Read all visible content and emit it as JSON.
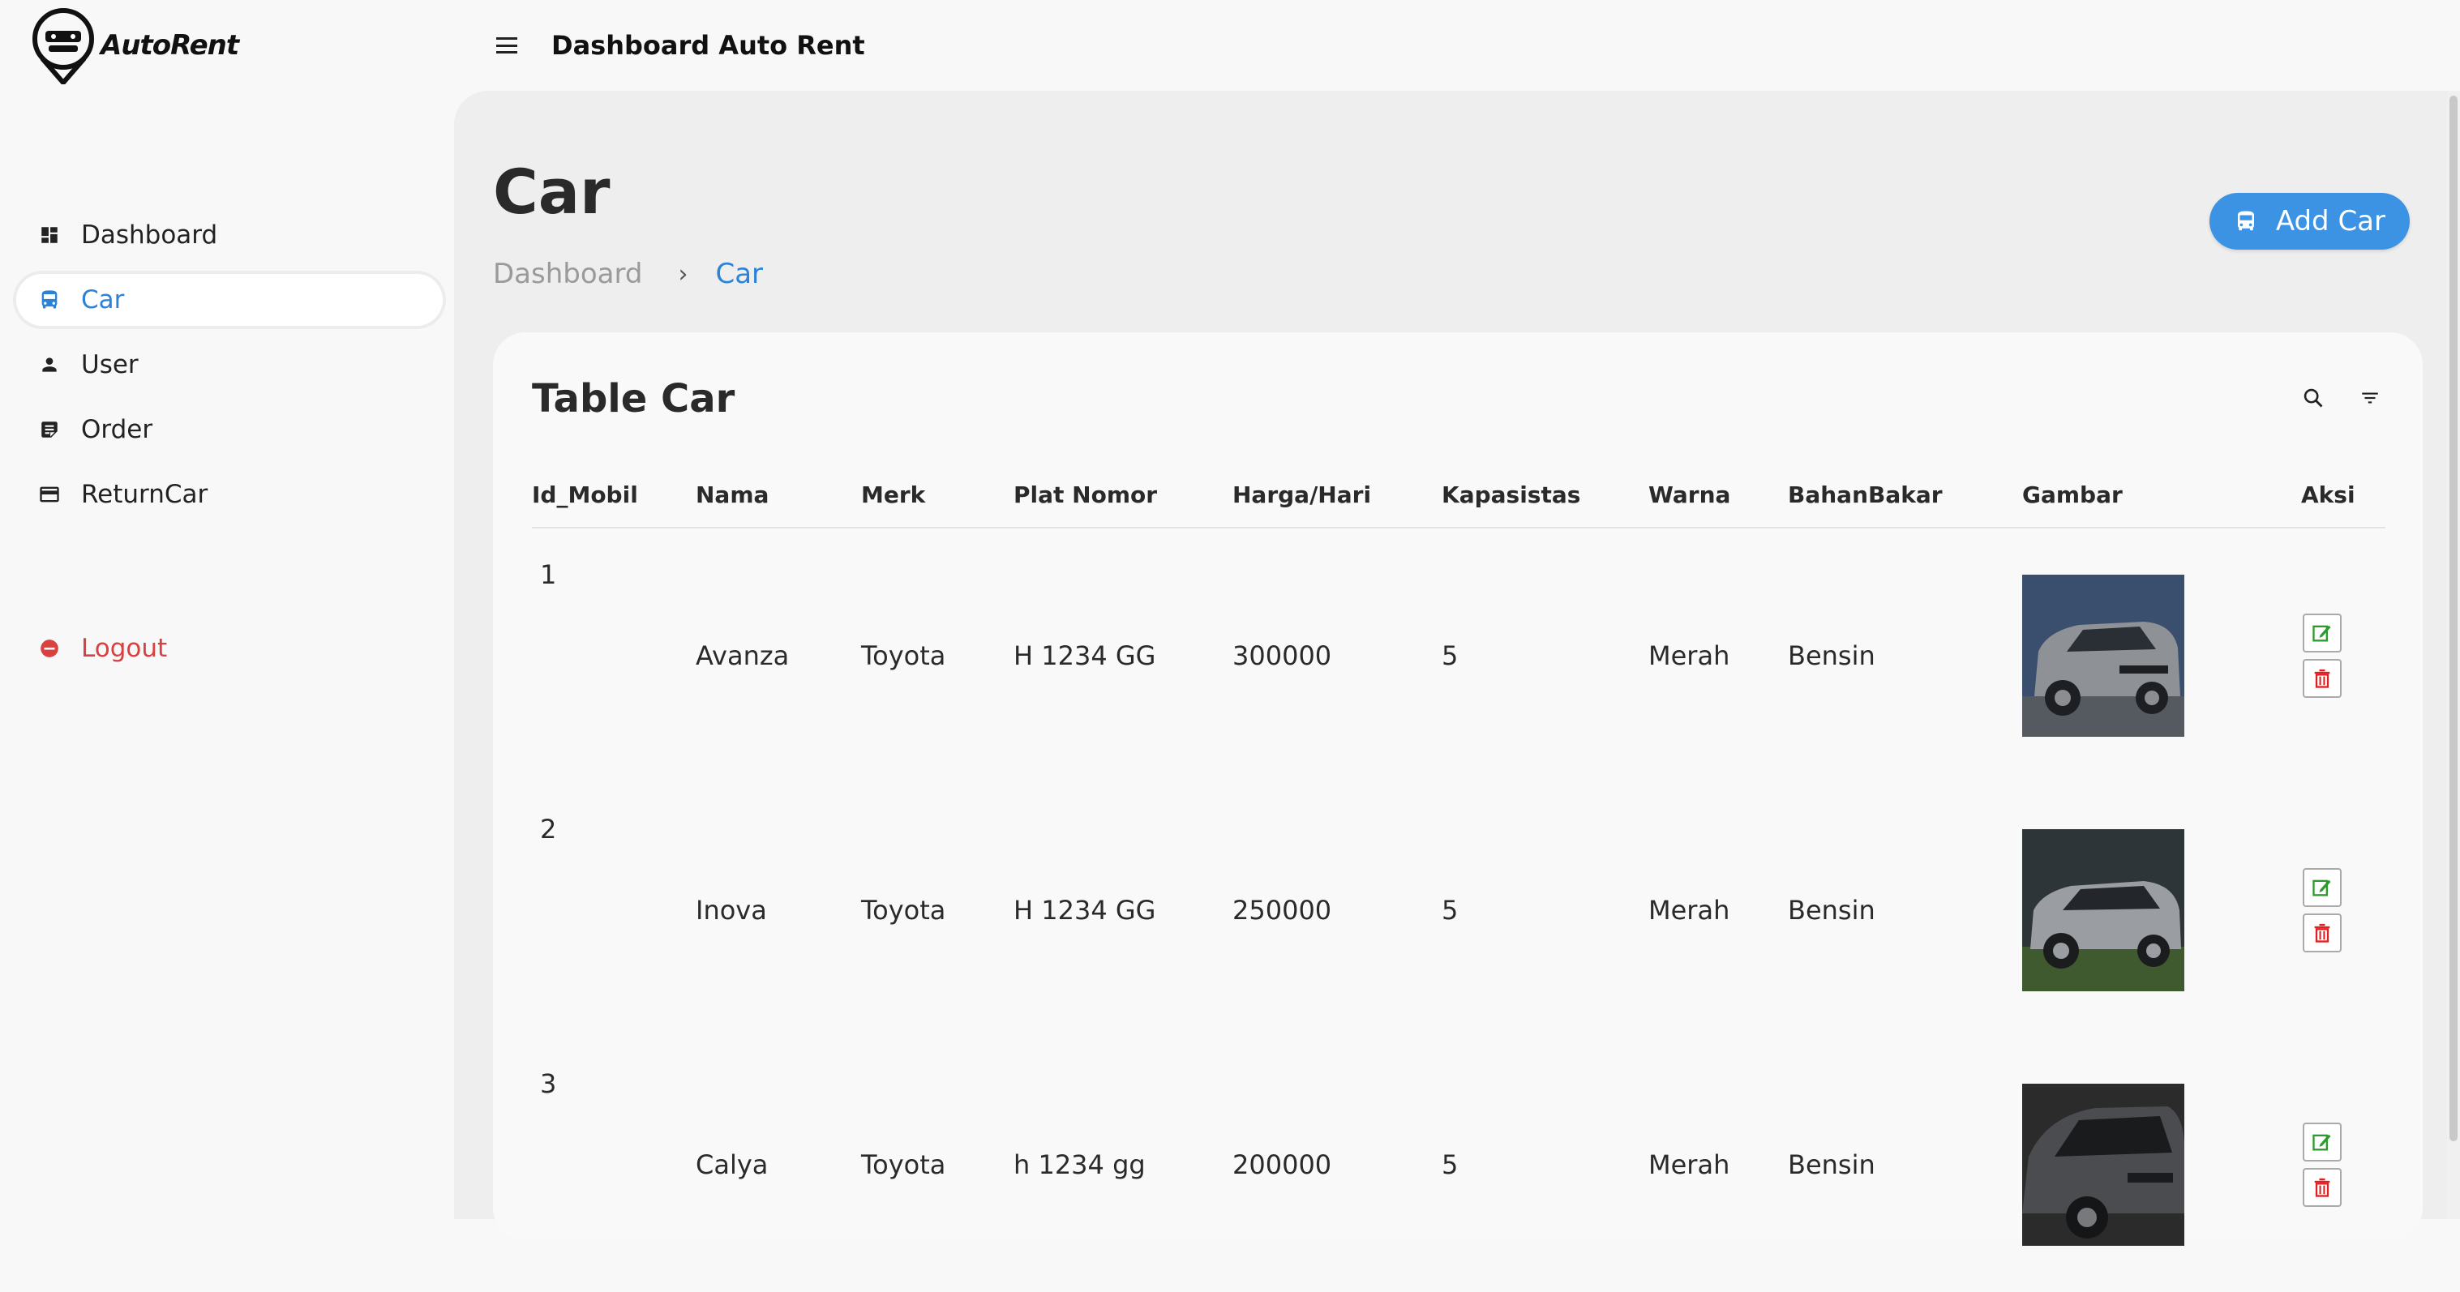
{
  "brand": {
    "name": "AutoRent"
  },
  "sidebar": {
    "items": [
      {
        "label": "Dashboard",
        "icon": "dashboard-icon"
      },
      {
        "label": "Car",
        "icon": "car-icon",
        "active": true
      },
      {
        "label": "User",
        "icon": "person-icon"
      },
      {
        "label": "Order",
        "icon": "order-icon"
      },
      {
        "label": "ReturnCar",
        "icon": "card-icon"
      }
    ],
    "logout": {
      "label": "Logout",
      "icon": "logout-icon"
    }
  },
  "topbar": {
    "title": "Dashboard Auto Rent"
  },
  "page": {
    "title": "Car",
    "breadcrumb": {
      "home": "Dashboard",
      "separator": "›",
      "current": "Car"
    },
    "add_button": "Add Car"
  },
  "table": {
    "title": "Table Car",
    "columns": [
      "Id_Mobil",
      "Nama",
      "Merk",
      "Plat Nomor",
      "Harga/Hari",
      "Kapasistas",
      "Warna",
      "BahanBakar",
      "Gambar",
      "Aksi"
    ],
    "rows": [
      {
        "id": "1",
        "nama": "Avanza",
        "merk": "Toyota",
        "plat": "H 1234 GG",
        "harga": "300000",
        "kapasitas": "5",
        "warna": "Merah",
        "bahan_bakar": "Bensin",
        "image_tone": "#8e9196"
      },
      {
        "id": "2",
        "nama": "Inova",
        "merk": "Toyota",
        "plat": "H 1234 GG",
        "harga": "250000",
        "kapasitas": "5",
        "warna": "Merah",
        "bahan_bakar": "Bensin",
        "image_tone": "#9a9ea3"
      },
      {
        "id": "3",
        "nama": "Calya",
        "merk": "Toyota",
        "plat": "h 1234 gg",
        "harga": "200000",
        "kapasitas": "5",
        "warna": "Merah",
        "bahan_bakar": "Bensin",
        "image_tone": "#4a4c50"
      }
    ]
  },
  "colors": {
    "accent": "#2b82d9",
    "button": "#3d93e3",
    "danger": "#d94040",
    "edit": "#2e9a2e",
    "delete": "#e02020"
  }
}
